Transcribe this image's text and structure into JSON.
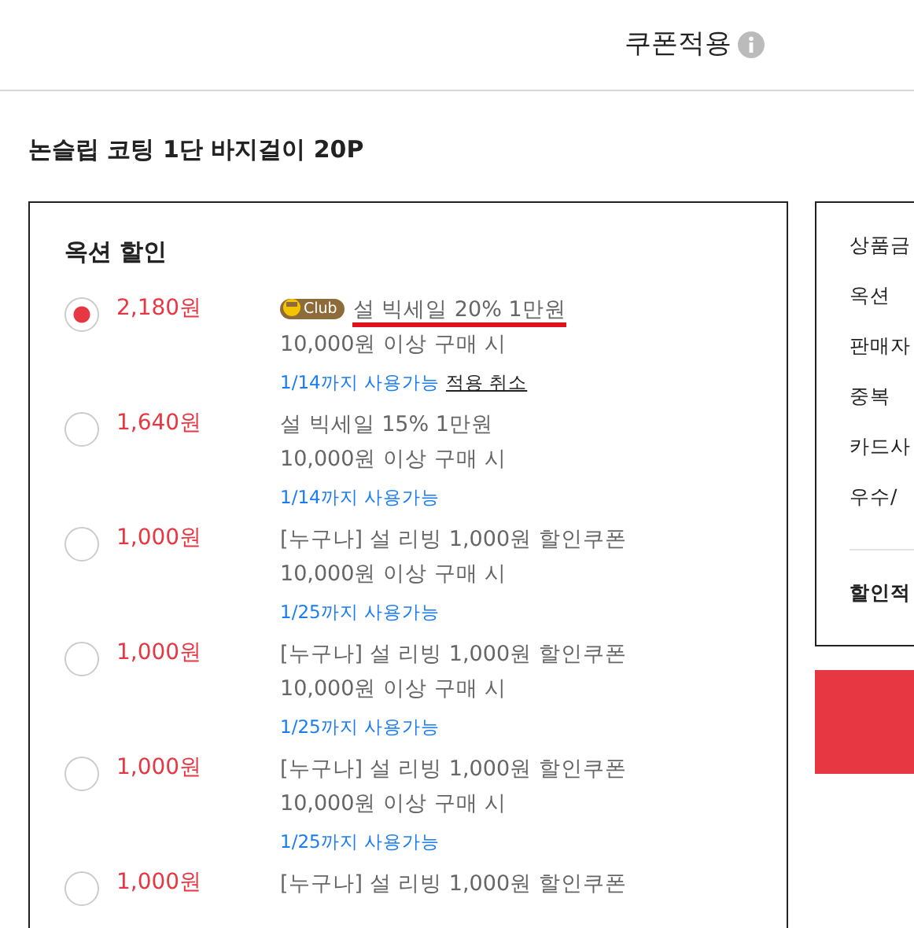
{
  "header": {
    "title": "쿠폰적용"
  },
  "product": {
    "name": "논슬립 코팅 1단 바지걸이 20P"
  },
  "option_discount": {
    "heading": "옥션 할인",
    "coupons": [
      {
        "price": "2,180원",
        "badge": "Club",
        "title": "설 빅세일 20% 1만원",
        "condition": "10,000원 이상 구매 시",
        "validity": "1/14까지 사용가능",
        "action": "적용 취소",
        "selected": true,
        "highlighted": true
      },
      {
        "price": "1,640원",
        "title": "설 빅세일 15% 1만원",
        "condition": "10,000원 이상 구매 시",
        "validity": "1/14까지 사용가능",
        "selected": false,
        "highlighted": false
      },
      {
        "price": "1,000원",
        "title": "[누구나] 설 리빙 1,000원 할인쿠폰",
        "condition": "10,000원 이상 구매 시",
        "validity": "1/25까지 사용가능",
        "selected": false,
        "highlighted": false
      },
      {
        "price": "1,000원",
        "title": "[누구나] 설 리빙 1,000원 할인쿠폰",
        "condition": "10,000원 이상 구매 시",
        "validity": "1/25까지 사용가능",
        "selected": false,
        "highlighted": false
      },
      {
        "price": "1,000원",
        "title": "[누구나] 설 리빙 1,000원 할인쿠폰",
        "condition": "10,000원 이상 구매 시",
        "validity": "1/25까지 사용가능",
        "selected": false,
        "highlighted": false
      },
      {
        "price": "1,000원",
        "title": "[누구나] 설 리빙 1,000원 할인쿠폰",
        "selected": false,
        "highlighted": false
      }
    ]
  },
  "summary": {
    "items": [
      "상품금",
      "옥션",
      "판매자",
      "중복",
      "카드사",
      "우수/"
    ],
    "total_label": "할인적"
  }
}
